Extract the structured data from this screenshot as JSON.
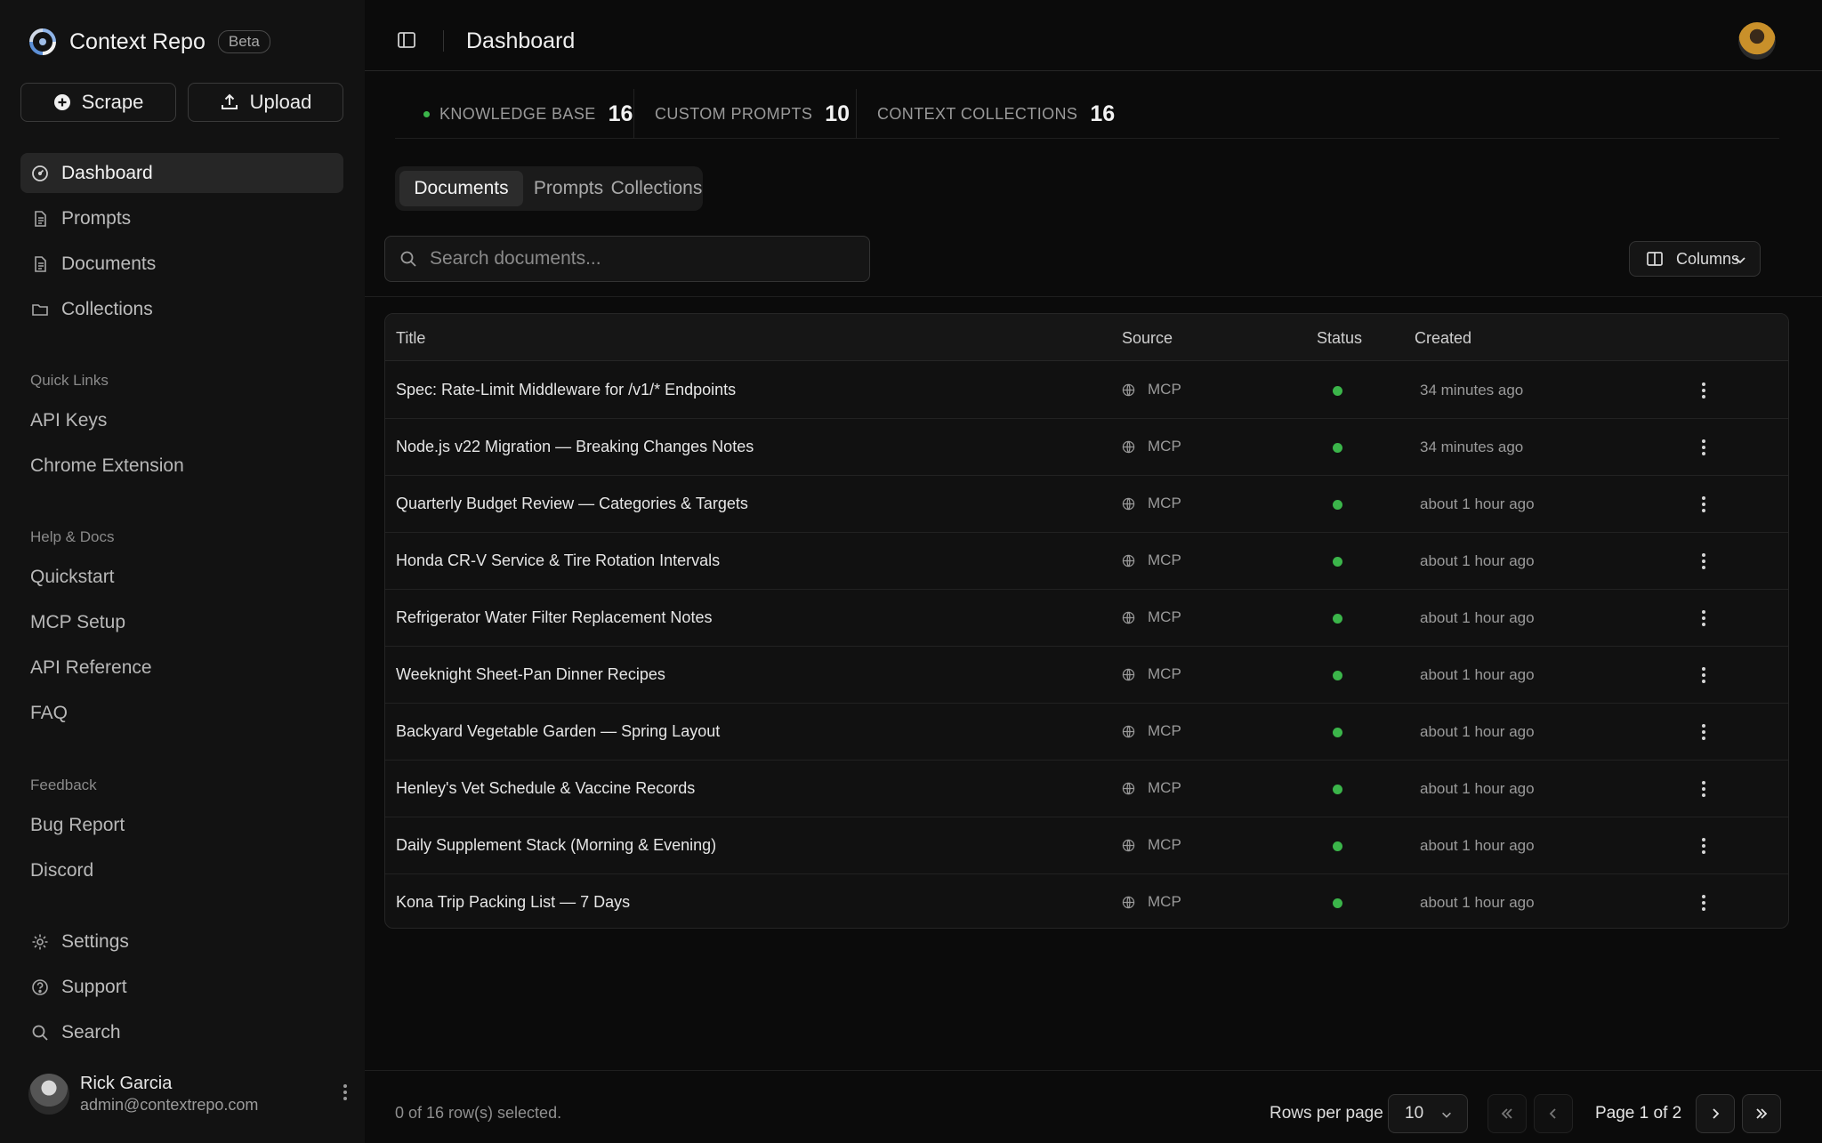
{
  "brand": {
    "name": "Context Repo",
    "badge": "Beta"
  },
  "actions": {
    "scrape": "Scrape",
    "upload": "Upload"
  },
  "nav": [
    {
      "label": "Dashboard",
      "icon": "dashboard-icon",
      "active": true
    },
    {
      "label": "Prompts",
      "icon": "file-text-icon"
    },
    {
      "label": "Documents",
      "icon": "file-text-icon"
    },
    {
      "label": "Collections",
      "icon": "folder-icon"
    }
  ],
  "sections": {
    "quick_links": {
      "label": "Quick Links",
      "items": [
        "API Keys",
        "Chrome Extension"
      ]
    },
    "help": {
      "label": "Help & Docs",
      "items": [
        "Quickstart",
        "MCP Setup",
        "API Reference",
        "FAQ"
      ]
    },
    "feedback": {
      "label": "Feedback",
      "items": [
        "Bug Report",
        "Discord"
      ]
    }
  },
  "bottom_nav": [
    {
      "label": "Settings",
      "icon": "gear-icon"
    },
    {
      "label": "Support",
      "icon": "help-circle-icon"
    },
    {
      "label": "Search",
      "icon": "search-icon"
    }
  ],
  "user": {
    "name": "Rick Garcia",
    "email": "admin@contextrepo.com"
  },
  "header": {
    "title": "Dashboard"
  },
  "stats": [
    {
      "label": "KNOWLEDGE BASE",
      "value": "16"
    },
    {
      "label": "CUSTOM PROMPTS",
      "value": "10"
    },
    {
      "label": "CONTEXT COLLECTIONS",
      "value": "16"
    }
  ],
  "tabs": [
    {
      "label": "Documents",
      "active": true
    },
    {
      "label": "Prompts"
    },
    {
      "label": "Collections"
    }
  ],
  "search": {
    "placeholder": "Search documents..."
  },
  "columns_button": "Columns",
  "table": {
    "headers": {
      "title": "Title",
      "source": "Source",
      "status": "Status",
      "created": "Created"
    },
    "rows": [
      {
        "title": "Spec: Rate-Limit Middleware for /v1/* Endpoints",
        "source": "MCP",
        "created": "34 minutes ago"
      },
      {
        "title": "Node.js v22 Migration — Breaking Changes Notes",
        "source": "MCP",
        "created": "34 minutes ago"
      },
      {
        "title": "Quarterly Budget Review — Categories & Targets",
        "source": "MCP",
        "created": "about 1 hour ago"
      },
      {
        "title": "Honda CR-V Service & Tire Rotation Intervals",
        "source": "MCP",
        "created": "about 1 hour ago"
      },
      {
        "title": "Refrigerator Water Filter Replacement Notes",
        "source": "MCP",
        "created": "about 1 hour ago"
      },
      {
        "title": "Weeknight Sheet-Pan Dinner Recipes",
        "source": "MCP",
        "created": "about 1 hour ago"
      },
      {
        "title": "Backyard Vegetable Garden — Spring Layout",
        "source": "MCP",
        "created": "about 1 hour ago"
      },
      {
        "title": "Henley's Vet Schedule & Vaccine Records",
        "source": "MCP",
        "created": "about 1 hour ago"
      },
      {
        "title": "Daily Supplement Stack (Morning & Evening)",
        "source": "MCP",
        "created": "about 1 hour ago"
      },
      {
        "title": "Kona Trip Packing List — 7 Days",
        "source": "MCP",
        "created": "about 1 hour ago"
      }
    ]
  },
  "footer": {
    "selection": "0 of 16 row(s) selected.",
    "rows_per_page_label": "Rows per page",
    "rows_per_page_value": "10",
    "page_info": "Page 1 of 2"
  },
  "colors": {
    "accent_green": "#3bb54a",
    "background": "#0b0b0b",
    "sidebar": "#121212"
  }
}
